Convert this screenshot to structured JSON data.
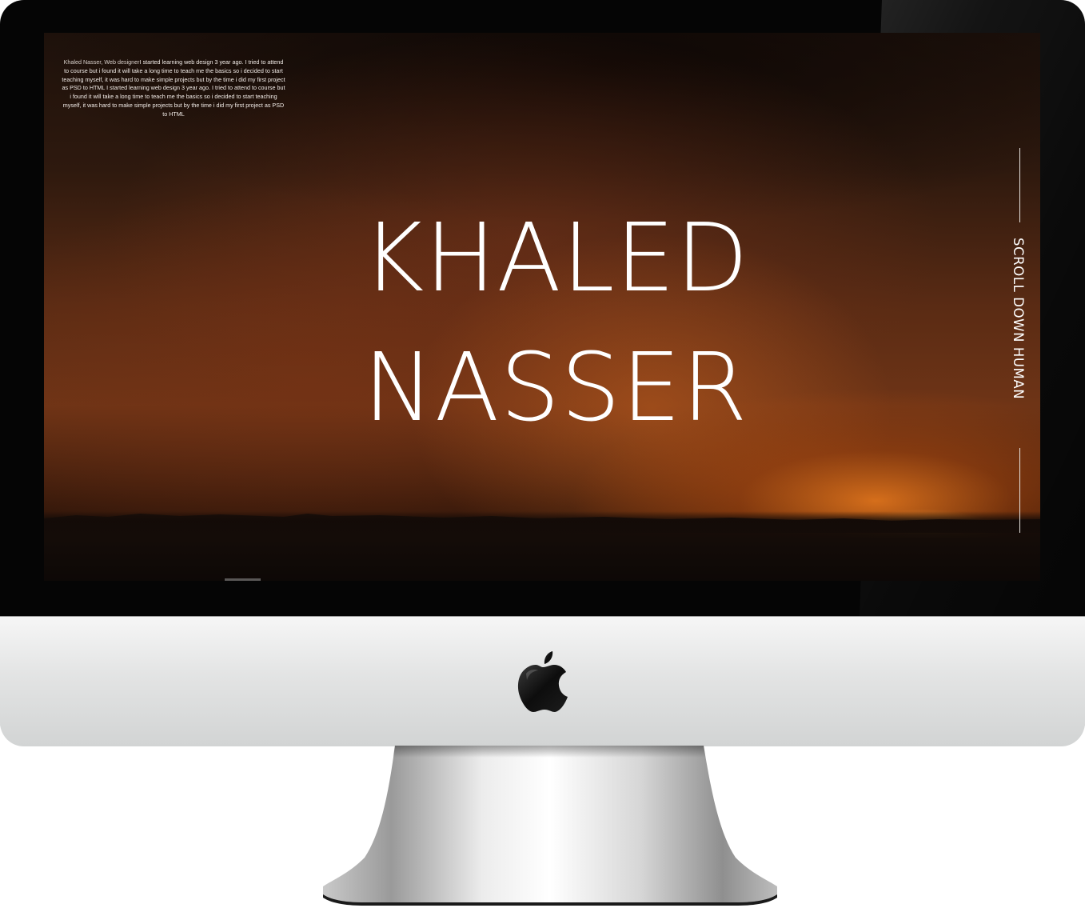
{
  "hero": {
    "first_name": "KHALED",
    "last_name": "NASSER"
  },
  "bio": {
    "name_title": "Khaled Nasser, Web designer",
    "text": "I started learning web design 3 year ago. I tried to attend to course but i found it will take a long time to teach me the basics so i decided to start teaching myself, it was hard to make simple projects but by the time i did my first project as PSD to HTML I started learning web design 3 year ago. I tried to attend to course but i found it will take a long time to teach me the basics so i decided to start teaching myself, it was hard to make simple projects but by the time i did my first project as PSD to HTML"
  },
  "scroll_indicator": {
    "label": "SCROLL DOWN HUMAN"
  },
  "device": {
    "logo_icon": "apple-logo-icon"
  },
  "colors": {
    "bezel": "#050505",
    "chin": "#d9dada",
    "text": "#ffffff",
    "sunset_accent": "#f08a2a"
  }
}
